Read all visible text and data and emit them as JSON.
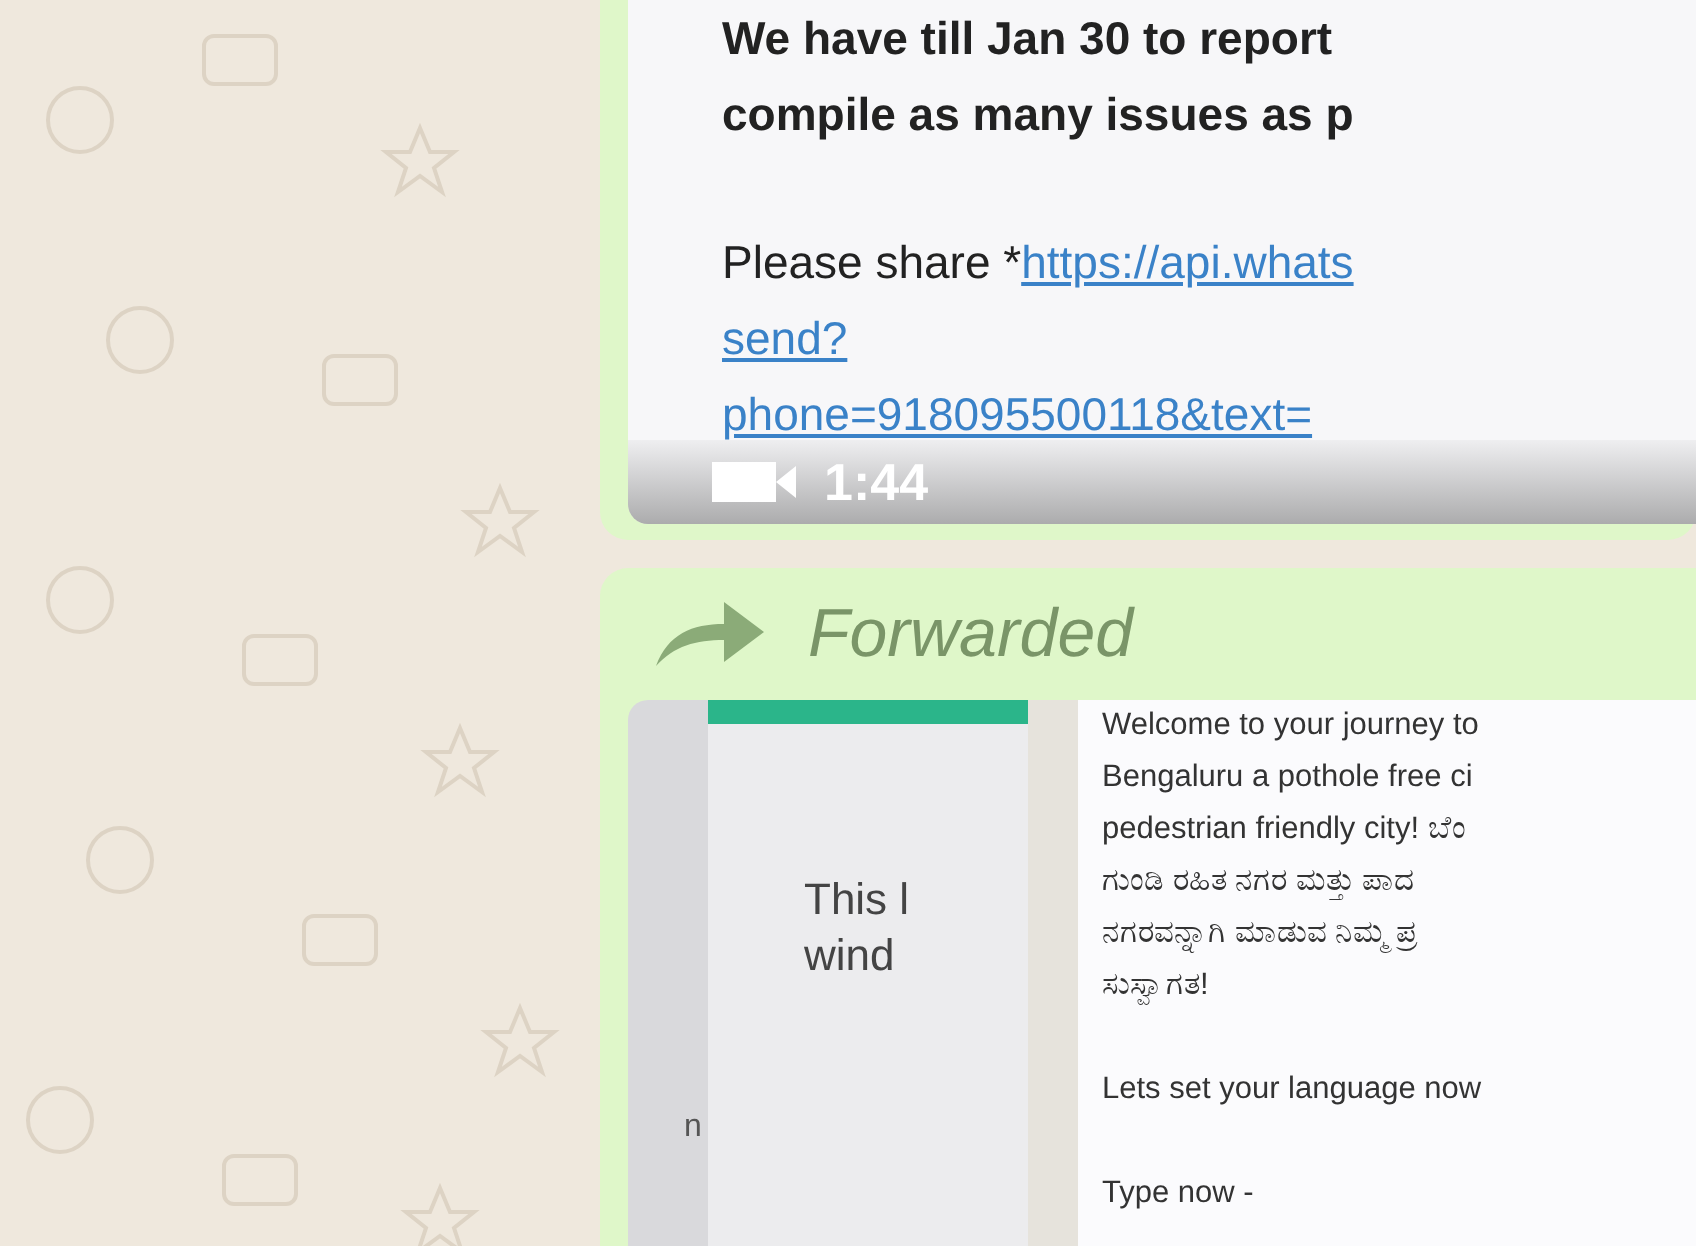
{
  "messages": [
    {
      "kind": "video",
      "paragraphs": [
        [
          [
            {
              "kind": "bold",
              "text": "We have till Jan 30 to report"
            }
          ],
          [
            {
              "kind": "bold",
              "text": "compile as many issues as p"
            }
          ]
        ],
        [
          [
            {
              "kind": "text",
              "text": "Please share *"
            },
            {
              "kind": "link",
              "text": "https://api.whats"
            }
          ],
          [
            {
              "kind": "link",
              "text": "send?"
            }
          ],
          [
            {
              "kind": "link",
              "text": "phone=918095500118&text="
            }
          ]
        ]
      ],
      "duration": "1:44"
    },
    {
      "kind": "image",
      "forwarded_label": "Forwarded",
      "side_fragment": "n",
      "dialog_lines": [
        "This l",
        "wind"
      ],
      "text_paragraphs": [
        [
          "Welcome to your journey to",
          "Bengaluru a pothole free ci",
          "pedestrian friendly city! ಬೆಂ",
          "ಗುಂಡಿ ರಹಿತ ನಗರ ಮತ್ತು ಪಾದ",
          "ನಗರವನ್ನಾಗಿ ಮಾಡುವ ನಿಮ್ಮ ಪ್ರ",
          "ಸುಸ್ವಾಗತ!"
        ],
        [
          "Lets set your language now"
        ],
        [
          "Type now -"
        ]
      ]
    }
  ]
}
